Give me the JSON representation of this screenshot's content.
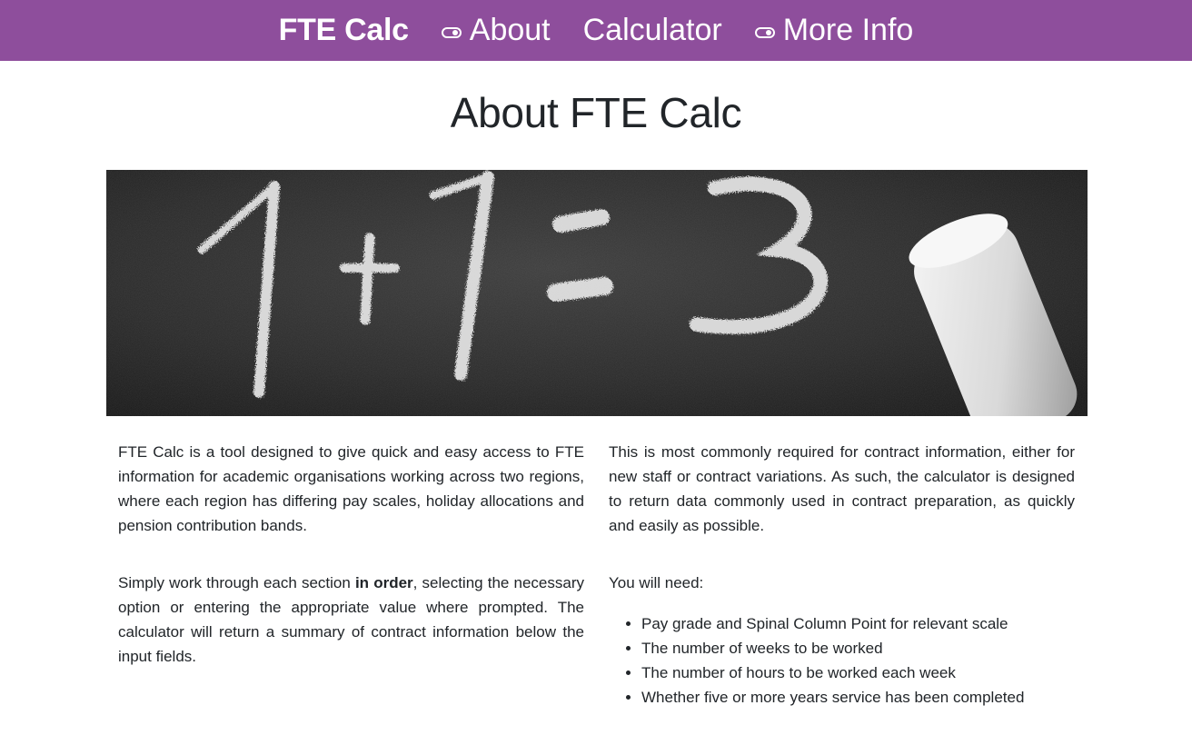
{
  "nav": {
    "brand": "FTE Calc",
    "items": [
      {
        "label": "About",
        "icon": "toggle-icon"
      },
      {
        "label": "Calculator",
        "icon": null
      },
      {
        "label": "More Info",
        "icon": "toggle-icon"
      }
    ],
    "background": "#8e4e9c"
  },
  "page": {
    "title": "About FTE Calc"
  },
  "hero": {
    "equation_glyphs": [
      "1",
      "+",
      "1",
      "=",
      "3"
    ],
    "icon": "chalkboard-image"
  },
  "left": {
    "p1": "FTE Calc is a tool designed to give quick and easy access to FTE information for academic organisations working across two regions, where each region has differing pay scales, holiday allocations and pension contribution bands.",
    "p2_before": "Simply work through each section ",
    "p2_bold": "in order",
    "p2_after": ", selecting the necessary option or entering the appropriate value where prompted. The calculator will return a summary of contract information below the input fields."
  },
  "right": {
    "p1": "This is most commonly required for contract information, either for new staff or contract variations. As such, the calculator is designed to return data commonly used in contract preparation, as quickly and easily as possible.",
    "p2": "You will need:",
    "needs": [
      "Pay grade and Spinal Column Point for relevant scale",
      "The number of weeks to be worked",
      "The number of hours to be worked each week",
      "Whether five or more years service has been completed"
    ]
  }
}
